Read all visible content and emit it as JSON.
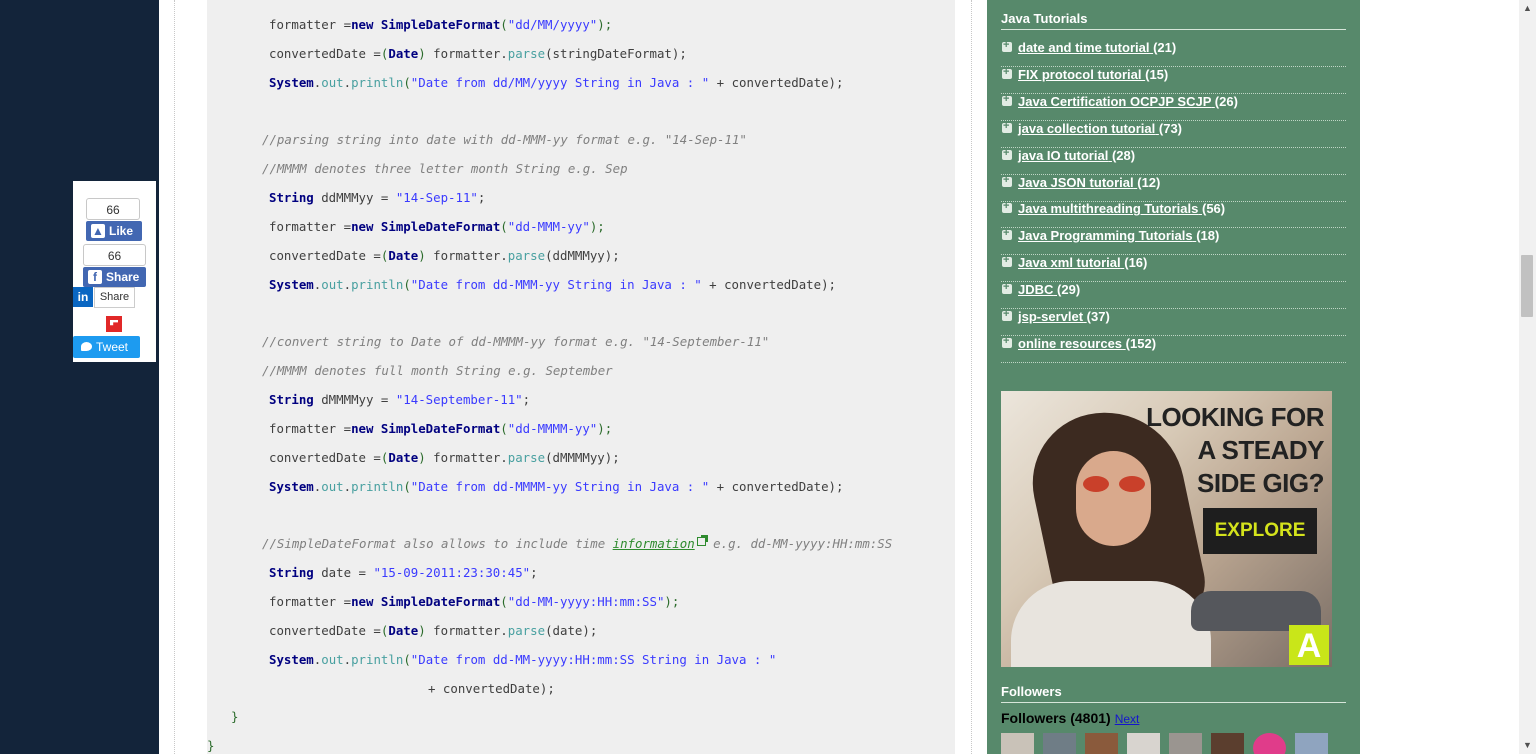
{
  "code": {
    "l1a": "formatter =",
    "l1b": "new",
    "l1c": "SimpleDateFormat",
    "l1d": "(",
    "l1e": "\"dd/MM/yyyy\"",
    "l1f": ");",
    "l2a": "convertedDate =",
    "l2b": "(",
    "l2c": "Date",
    "l2d": ")",
    "l2e": " formatter.",
    "l2f": "parse",
    "l2g": "(stringDateFormat);",
    "l3a": "System",
    "l3b": ".",
    "l3c": "out",
    "l3d": ".",
    "l3e": "println",
    "l3f": "(",
    "l3g": "\"Date from dd/MM/yyyy String in Java : \"",
    "l3h": " + convertedDate);",
    "c1": "//parsing string into date with dd-MMM-yy format e.g. \"14-Sep-11\"",
    "c2": "//MMMM denotes three letter month String e.g. Sep",
    "l4a": "String",
    "l4b": " ddMMMyy = ",
    "l4c": "\"14-Sep-11\"",
    "l4d": ";",
    "l5e": "\"dd-MMM-yy\"",
    "l6g": "(ddMMMyy);",
    "l7g": "\"Date from dd-MMM-yy String in Java : \"",
    "c3": "//convert string to Date of dd-MMMM-yy format e.g. \"14-September-11\"",
    "c4": "//MMMM denotes full month String e.g. September",
    "l8b": " dMMMMyy = ",
    "l8c": "\"14-September-11\"",
    "l9e": "\"dd-MMMM-yy\"",
    "l10g": "(dMMMMyy);",
    "l11g": "\"Date from dd-MMMM-yy String in Java : \"",
    "c5a": "//SimpleDateFormat also allows to include time ",
    "c5link": "information",
    "c5b": " e.g. dd-MM-yyyy:HH:mm:SS",
    "l12b": " date = ",
    "l12c": "\"15-09-2011:23:30:45\"",
    "l13e": "\"dd-MM-yyyy:HH:mm:SS\"",
    "l14g": "(date);",
    "l15g": "\"Date from dd-MM-yyyy:HH:mm:SS String in Java : \"",
    "l16": "+ convertedDate);",
    "brace1": "}",
    "brace2": "}"
  },
  "sidebar": {
    "tutorials_title": "Java Tutorials",
    "categories": [
      {
        "label": "date and time tutorial",
        "count": "(21)"
      },
      {
        "label": "FIX protocol tutorial",
        "count": "(15)"
      },
      {
        "label": "Java Certification OCPJP SCJP",
        "count": "(26)"
      },
      {
        "label": "java collection tutorial",
        "count": "(73)"
      },
      {
        "label": "java IO tutorial",
        "count": "(28)"
      },
      {
        "label": "Java JSON tutorial",
        "count": "(12)"
      },
      {
        "label": "Java multithreading Tutorials",
        "count": "(56)"
      },
      {
        "label": "Java Programming Tutorials",
        "count": "(18)"
      },
      {
        "label": "Java xml tutorial",
        "count": "(16)"
      },
      {
        "label": "JDBC",
        "count": "(29)"
      },
      {
        "label": "jsp-servlet",
        "count": "(37)"
      },
      {
        "label": "online resources",
        "count": "(152)"
      }
    ],
    "ad": {
      "line1": "LOOKING FOR",
      "line2": "A STEADY",
      "line3": "SIDE GIG?",
      "button": "EXPLORE",
      "logo": "A"
    },
    "followers_title": "Followers",
    "followers_label": "Followers (4801)",
    "followers_next": "Next"
  },
  "share": {
    "like_count": "66",
    "like_label": "Like",
    "share_count": "66",
    "share_label": "Share",
    "linkedin_label": "Share",
    "tweet_label": "Tweet"
  }
}
